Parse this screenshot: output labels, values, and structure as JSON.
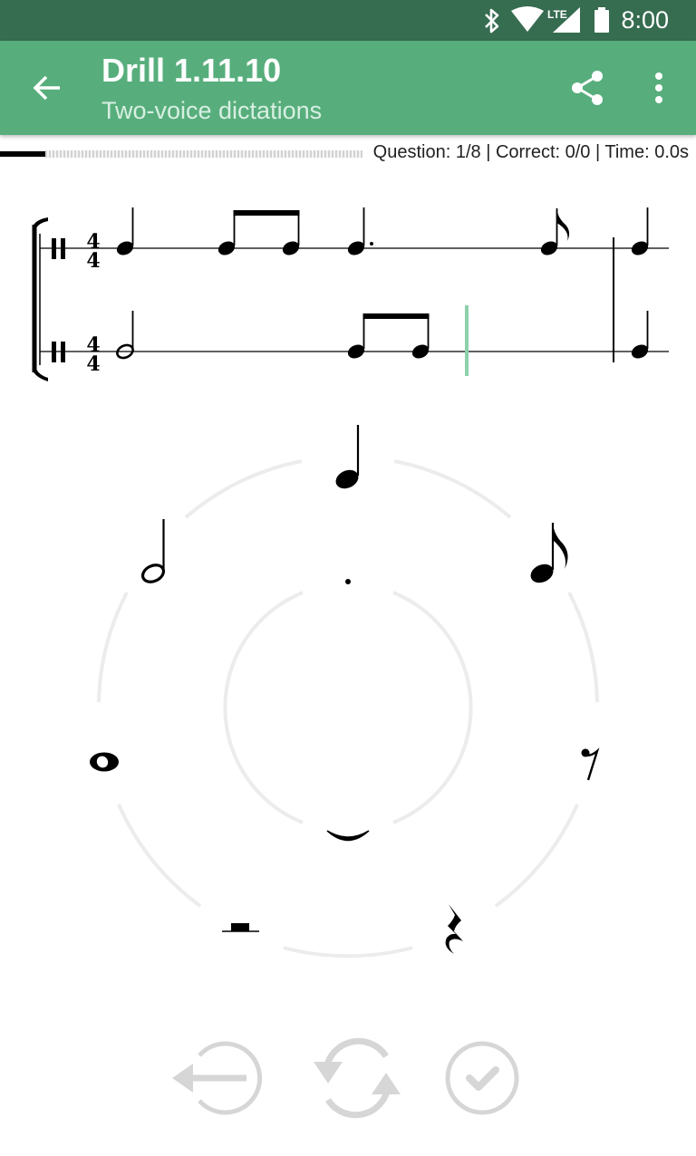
{
  "status_bar": {
    "time": "8:00",
    "network": "LTE",
    "icons": [
      "bluetooth-icon",
      "wifi-icon",
      "lte-signal-icon",
      "battery-icon"
    ]
  },
  "app_bar": {
    "title": "Drill 1.11.10",
    "subtitle": "Two-voice dictations",
    "icons": [
      "back-arrow-icon",
      "share-icon",
      "more-vert-icon"
    ]
  },
  "progress": {
    "fraction": 0.125,
    "stats": "Question: 1/8 | Correct: 0/0 | Time: 0.0s"
  },
  "score": {
    "time_signature": {
      "top": "4",
      "bottom": "4"
    },
    "upper_voice": [
      "quarter",
      "eighth",
      "eighth",
      "dotted-quarter",
      "eighth",
      "quarter"
    ],
    "lower_voice": [
      "half",
      "eighth",
      "eighth",
      "quarter"
    ]
  },
  "note_wheel": {
    "outer": [
      "quarter-note",
      "eighth-note",
      "eighth-rest",
      "quarter-rest",
      "tie",
      "half-rest",
      "whole-note",
      "half-note"
    ],
    "inner": [
      "dot"
    ]
  },
  "colors": {
    "status_bar": "#366c50",
    "app_bar": "#57ae7c",
    "cursor": "#8ed1ad",
    "control_gray": "#d6d6d6",
    "wheel_ring": "#ececec"
  },
  "controls": [
    "undo-icon",
    "refresh-icon",
    "check-icon"
  ]
}
